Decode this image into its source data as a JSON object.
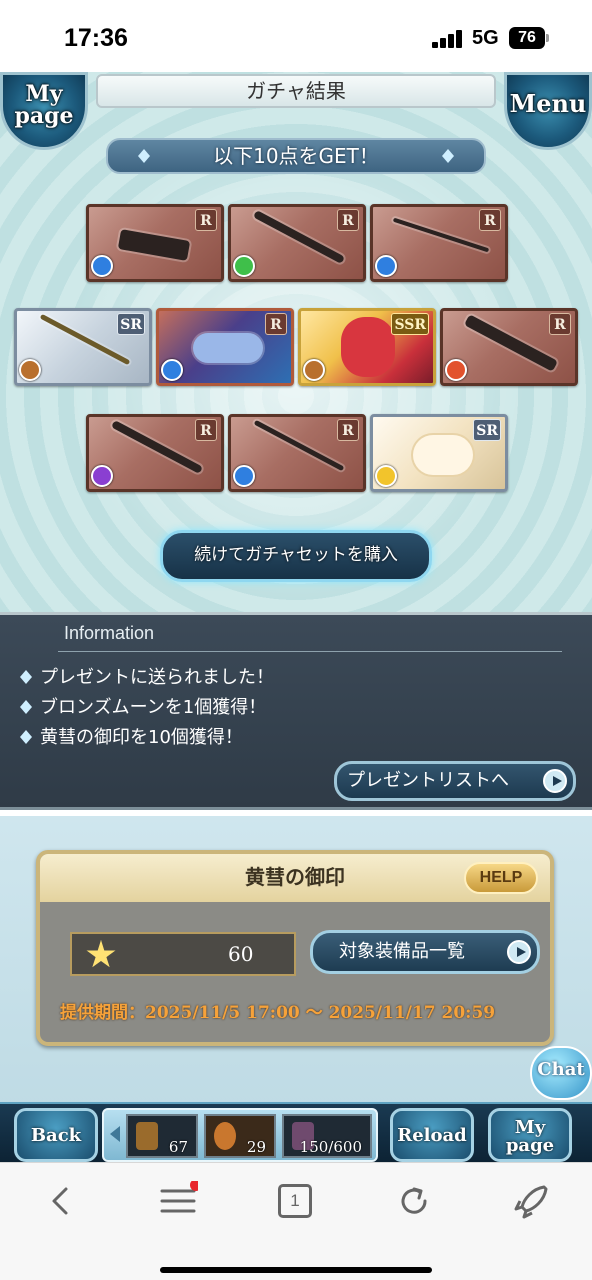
{
  "status_bar": {
    "time": "17:36",
    "network": "5G",
    "battery": "76"
  },
  "header": {
    "mypage_label": "My page",
    "title": "ガチャ結果",
    "menu_label": "Menu"
  },
  "results": {
    "banner": "以下10点をGET！",
    "cards": [
      {
        "rarity": "R",
        "element": "water",
        "kind": "weapon-gauntlet"
      },
      {
        "rarity": "R",
        "element": "wind",
        "kind": "weapon-axe"
      },
      {
        "rarity": "R",
        "element": "water",
        "kind": "weapon-bow"
      },
      {
        "rarity": "SR",
        "element": "earth",
        "kind": "weapon-spear"
      },
      {
        "rarity": "R",
        "element": "water",
        "kind": "summon-fish"
      },
      {
        "rarity": "SSR",
        "element": "earth",
        "kind": "character"
      },
      {
        "rarity": "R",
        "element": "fire",
        "kind": "weapon-gun"
      },
      {
        "rarity": "R",
        "element": "dark",
        "kind": "weapon-blade"
      },
      {
        "rarity": "R",
        "element": "water",
        "kind": "weapon-staff"
      },
      {
        "rarity": "SR",
        "element": "light",
        "kind": "summon-sheep"
      }
    ],
    "continue_label": "続けてガチャセットを購入"
  },
  "information": {
    "title": "Information",
    "messages": [
      "プレゼントに送られました！",
      "ブロンズムーンを1個獲得！",
      "黄彗の御印を10個獲得！"
    ],
    "present_list_label": "プレゼントリストへ"
  },
  "seal": {
    "title": "黄彗の御印",
    "help_label": "HELP",
    "count": "60",
    "equip_list_label": "対象装備品一覧",
    "period": "提供期間：2025/11/5 17:00 〜 2025/11/17 20:59"
  },
  "chat_label": "Chat",
  "game_bar": {
    "back_label": "Back",
    "reload_label": "Reload",
    "mypage_label": "My page",
    "items": [
      {
        "name": "item-1",
        "count": "67"
      },
      {
        "name": "item-2",
        "count": "29"
      },
      {
        "name": "item-3",
        "count": "150/600"
      }
    ]
  },
  "browser_toolbar": {
    "tab_count": "1",
    "icons": [
      "back-icon",
      "menu-icon",
      "tabs-icon",
      "refresh-icon",
      "rocket-icon"
    ]
  },
  "colors": {
    "accent_gold": "#f6a23a",
    "panel_blue": "#1d3a50",
    "info_bg": "#3c4a58"
  }
}
